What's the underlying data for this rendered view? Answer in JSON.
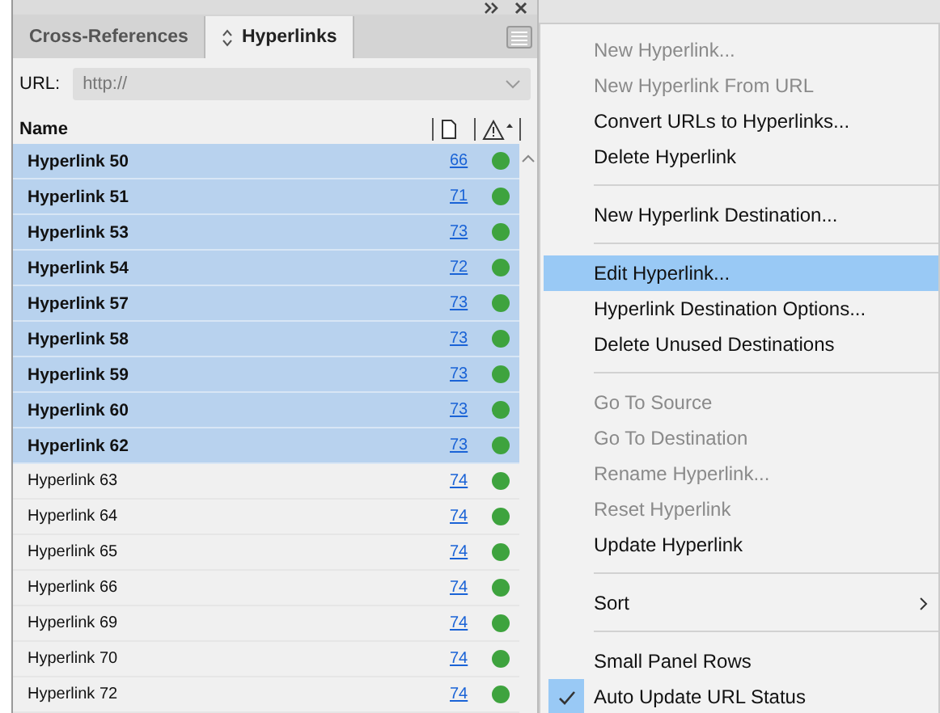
{
  "tabs": [
    {
      "label": "Cross-References",
      "selected": false
    },
    {
      "label": "Hyperlinks",
      "selected": true
    }
  ],
  "url_field": {
    "label": "URL:",
    "placeholder": "http://"
  },
  "columns": [
    {
      "label": "Name"
    }
  ],
  "rows": [
    {
      "name": "Hyperlink 50",
      "page": "66",
      "selected": true
    },
    {
      "name": "Hyperlink 51",
      "page": "71",
      "selected": true
    },
    {
      "name": "Hyperlink 53",
      "page": "73",
      "selected": true
    },
    {
      "name": "Hyperlink 54",
      "page": "72",
      "selected": true
    },
    {
      "name": "Hyperlink 57",
      "page": "73",
      "selected": true
    },
    {
      "name": "Hyperlink 58",
      "page": "73",
      "selected": true
    },
    {
      "name": "Hyperlink 59",
      "page": "73",
      "selected": true
    },
    {
      "name": "Hyperlink 60",
      "page": "73",
      "selected": true
    },
    {
      "name": "Hyperlink 62",
      "page": "73",
      "selected": true
    },
    {
      "name": "Hyperlink 63",
      "page": "74",
      "selected": false
    },
    {
      "name": "Hyperlink 64",
      "page": "74",
      "selected": false
    },
    {
      "name": "Hyperlink 65",
      "page": "74",
      "selected": false
    },
    {
      "name": "Hyperlink 66",
      "page": "74",
      "selected": false
    },
    {
      "name": "Hyperlink 69",
      "page": "74",
      "selected": false
    },
    {
      "name": "Hyperlink 70",
      "page": "74",
      "selected": false
    },
    {
      "name": "Hyperlink 72",
      "page": "74",
      "selected": false
    }
  ],
  "menu": [
    {
      "kind": "item",
      "label": "New Hyperlink...",
      "disabled": true,
      "selected": false
    },
    {
      "kind": "item",
      "label": "New Hyperlink From URL",
      "disabled": true,
      "selected": false
    },
    {
      "kind": "item",
      "label": "Convert URLs to Hyperlinks...",
      "disabled": false,
      "selected": false
    },
    {
      "kind": "item",
      "label": "Delete Hyperlink",
      "disabled": false,
      "selected": false
    },
    {
      "kind": "separator"
    },
    {
      "kind": "item",
      "label": "New Hyperlink Destination...",
      "disabled": false,
      "selected": false
    },
    {
      "kind": "separator"
    },
    {
      "kind": "item",
      "label": "Edit Hyperlink...",
      "disabled": false,
      "selected": true
    },
    {
      "kind": "item",
      "label": "Hyperlink Destination Options...",
      "disabled": false,
      "selected": false
    },
    {
      "kind": "item",
      "label": "Delete Unused Destinations",
      "disabled": false,
      "selected": false
    },
    {
      "kind": "separator"
    },
    {
      "kind": "item",
      "label": "Go To Source",
      "disabled": true,
      "selected": false
    },
    {
      "kind": "item",
      "label": "Go To Destination",
      "disabled": true,
      "selected": false
    },
    {
      "kind": "item",
      "label": "Rename Hyperlink...",
      "disabled": true,
      "selected": false
    },
    {
      "kind": "item",
      "label": "Reset Hyperlink",
      "disabled": true,
      "selected": false
    },
    {
      "kind": "item",
      "label": "Update Hyperlink",
      "disabled": false,
      "selected": false
    },
    {
      "kind": "separator"
    },
    {
      "kind": "submenu",
      "label": "Sort",
      "disabled": false,
      "selected": false
    },
    {
      "kind": "separator"
    },
    {
      "kind": "item",
      "label": "Small Panel Rows",
      "disabled": false,
      "selected": false,
      "checked": false
    },
    {
      "kind": "item",
      "label": "Auto Update URL Status",
      "disabled": false,
      "selected": false,
      "checked": true
    }
  ]
}
